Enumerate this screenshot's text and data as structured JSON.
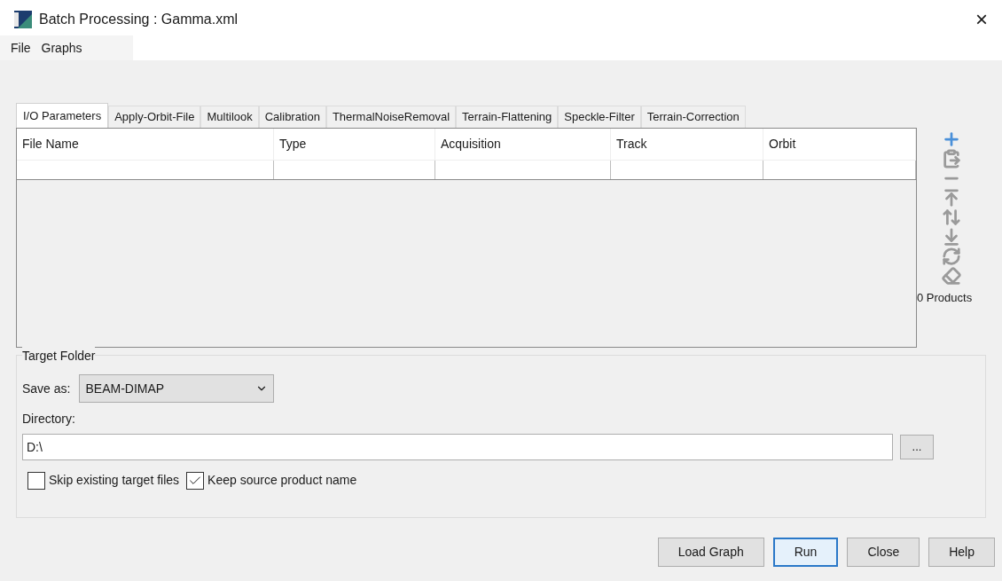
{
  "window": {
    "title": "Batch Processing : Gamma.xml",
    "close": "×"
  },
  "menu": [
    "File",
    "Graphs"
  ],
  "tabs": [
    {
      "label": "I/O Parameters",
      "selected": true
    },
    {
      "label": "Apply-Orbit-File",
      "selected": false
    },
    {
      "label": "Multilook",
      "selected": false
    },
    {
      "label": "Calibration",
      "selected": false
    },
    {
      "label": "ThermalNoiseRemoval",
      "selected": false
    },
    {
      "label": "Terrain-Flattening",
      "selected": false
    },
    {
      "label": "Speckle-Filter",
      "selected": false
    },
    {
      "label": "Terrain-Correction",
      "selected": false
    }
  ],
  "table": {
    "columns": [
      "File Name",
      "Type",
      "Acquisition",
      "Track",
      "Orbit"
    ]
  },
  "product_count": "0 Products",
  "target_folder": {
    "title": "Target Folder",
    "save_as_label": "Save as:",
    "save_as_value": "BEAM-DIMAP",
    "directory_label": "Directory:",
    "directory_value": "D:\\",
    "browse": "...",
    "options": [
      {
        "label": "Skip existing target files",
        "checked": false
      },
      {
        "label": "Keep source product name",
        "checked": true
      }
    ]
  },
  "buttons": [
    {
      "label": "Load Graph",
      "default": false
    },
    {
      "label": "Run",
      "default": true
    },
    {
      "label": "Close",
      "default": false
    },
    {
      "label": "Help",
      "default": false
    }
  ]
}
